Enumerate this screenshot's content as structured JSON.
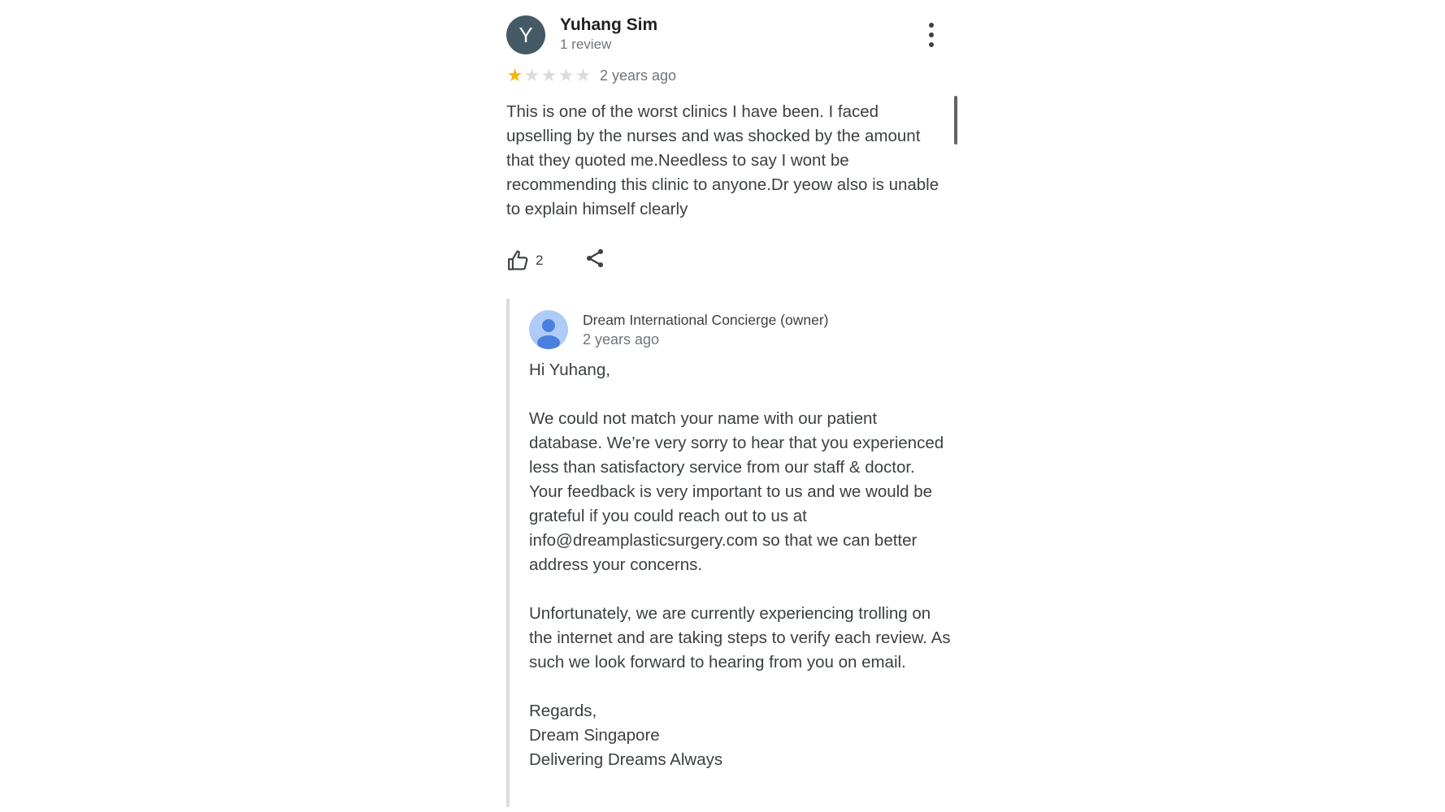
{
  "review": {
    "avatar_letter": "Y",
    "author_name": "Yuhang Sim",
    "author_sub": "1 review",
    "rating": 1,
    "rating_max": 5,
    "date": "2 years ago",
    "text": "This is one of the worst clinics I have been. I faced upselling by the nurses and was shocked by the amount that they quoted me.Needless to say I wont be recommending this clinic to anyone.Dr yeow also is unable to explain himself clearly",
    "like_count": "2",
    "icons": {
      "more": "more-vert-icon",
      "like": "thumbs-up-icon",
      "share": "share-icon",
      "star": "star-icon"
    }
  },
  "owner_reply": {
    "name": "Dream International Concierge (owner)",
    "date": "2 years ago",
    "greeting": "Hi Yuhang,",
    "paragraph1": "We could not match your name with our patient database. We’re very sorry to hear that you experienced less than satisfactory service from our staff & doctor. Your feedback is very important to us and we would be grateful if you could reach out to us at info@dreamplasticsurgery.com so that we can better address your concerns.",
    "paragraph2": "Unfortunately, we are currently experiencing trolling on the internet and are taking steps to verify each review. As such we look forward to hearing from you on email.",
    "signoff1": "Regards,",
    "signoff2": "Dream Singapore",
    "signoff3": "Delivering Dreams Always",
    "avatar_icon": "person-avatar-icon"
  },
  "colors": {
    "star_filled": "#f4b400",
    "star_empty": "#dadce0",
    "avatar_bg": "#455a64",
    "owner_avatar_bg": "#aecbfa",
    "owner_avatar_fg": "#4a7fe0"
  }
}
